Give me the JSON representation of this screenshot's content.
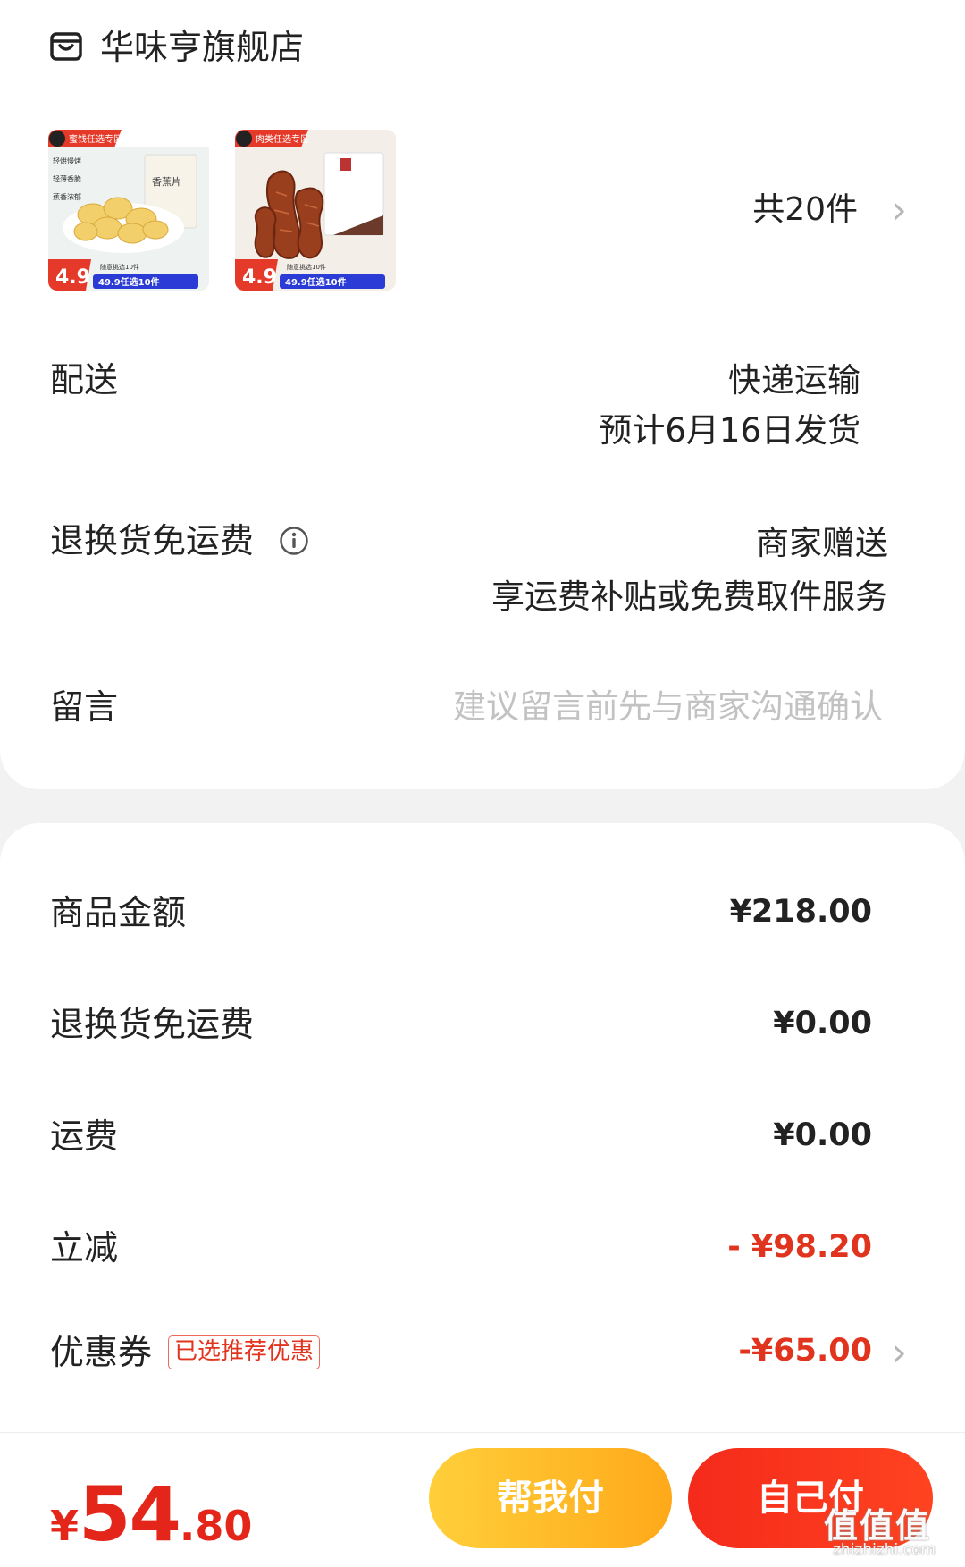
{
  "store": {
    "name": "华味亨旗舰店",
    "icon": "store-icon"
  },
  "products": {
    "items": [
      {
        "banner": "蜜饯任选专区",
        "lines": [
          "轻烘慢烤",
          "轻薄香脆",
          "蕉香浓郁"
        ],
        "pack_text": "香蕉片",
        "price": "4.9",
        "promo": "49.9任选10件",
        "promo_small": "随意挑选10件"
      },
      {
        "banner": "肉类任选专区",
        "lines": [],
        "pack_text": "",
        "price": "4.9",
        "promo": "49.9任选10件",
        "promo_small": "随意挑选10件"
      }
    ],
    "count_label": "共20件"
  },
  "delivery": {
    "label": "配送",
    "method": "快递运输",
    "eta": "预计6月16日发货"
  },
  "return_shipping": {
    "label": "退换货免运费",
    "value": "商家赠送",
    "desc": "享运费补贴或免费取件服务"
  },
  "message": {
    "label": "留言",
    "placeholder": "建议留言前先与商家沟通确认"
  },
  "summary": {
    "goods_amount": {
      "label": "商品金额",
      "value": "¥218.00"
    },
    "return_fee": {
      "label": "退换货免运费",
      "value": "¥0.00"
    },
    "shipping": {
      "label": "运费",
      "value": "¥0.00"
    },
    "discount": {
      "label": "立减",
      "value": "- ¥98.20"
    },
    "coupon": {
      "label": "优惠券",
      "badge": "已选推荐优惠",
      "value": "-¥65.00"
    }
  },
  "footer": {
    "total": {
      "yen": "¥",
      "int": "54",
      "dec": ".80"
    },
    "help_pay": "帮我付",
    "self_pay": "自己付"
  },
  "watermark": {
    "main": "值值值",
    "sub": "zhizhizhi.com"
  },
  "colors": {
    "accent_red": "#e1341e",
    "help_button": "#ffb824",
    "self_button": "#f42a1b",
    "background": "#f2f2f2"
  }
}
